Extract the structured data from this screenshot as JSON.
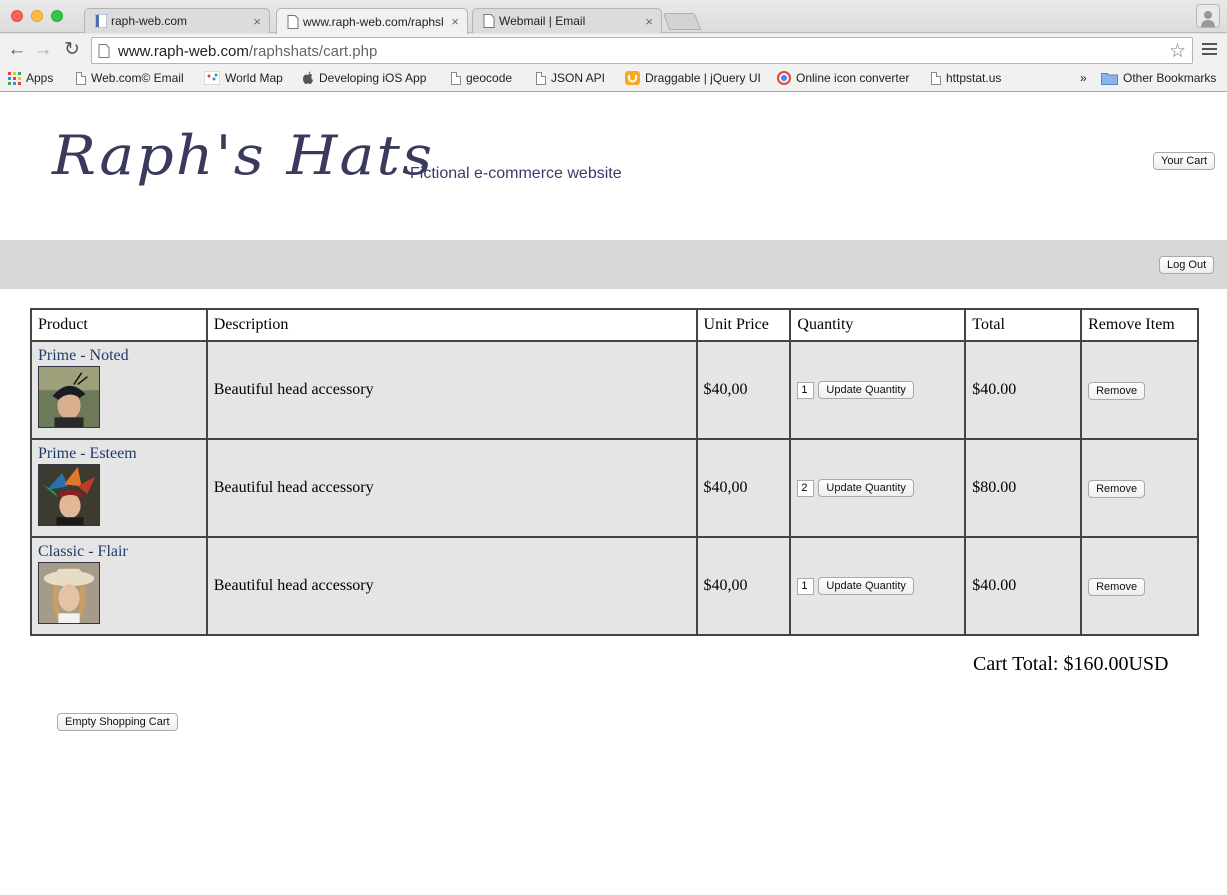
{
  "browser": {
    "tabs": [
      {
        "label": "raph-web.com",
        "active": false
      },
      {
        "label": "www.raph-web.com/raphsl",
        "active": true
      },
      {
        "label": "Webmail | Email",
        "active": false
      }
    ],
    "close_glyph": "×",
    "url_host": "www.raph-web.com",
    "url_path": "/raphshats/cart.php",
    "bookmarks": [
      {
        "label": "Apps",
        "icon": "apps-grid-icon"
      },
      {
        "label": "Web.com© Email",
        "icon": "page-icon"
      },
      {
        "label": "World Map",
        "icon": "map-icon"
      },
      {
        "label": "Developing iOS App",
        "icon": "apple-icon"
      },
      {
        "label": "geocode",
        "icon": "page-icon"
      },
      {
        "label": "JSON API",
        "icon": "page-icon"
      },
      {
        "label": "Draggable | jQuery UI",
        "icon": "jquery-icon"
      },
      {
        "label": "Online icon converter",
        "icon": "converter-icon"
      },
      {
        "label": "httpstat.us",
        "icon": "page-icon"
      }
    ],
    "overflow_label": "»",
    "other_bookmarks": "Other Bookmarks"
  },
  "site": {
    "logo": "Raph's Hats",
    "tagline": "Fictional e-commerce website",
    "cart_button": "Your Cart",
    "logout_button": "Log Out"
  },
  "cart": {
    "headers": [
      "Product",
      "Description",
      "Unit Price",
      "Quantity",
      "Total",
      "Remove Item"
    ],
    "items": [
      {
        "name": "Prime - Noted",
        "description": "Beautiful head accessory",
        "unit_price": "$40,00",
        "quantity": "1",
        "total": "$40.00"
      },
      {
        "name": "Prime - Esteem",
        "description": "Beautiful head accessory",
        "unit_price": "$40,00",
        "quantity": "2",
        "total": "$80.00"
      },
      {
        "name": "Classic - Flair",
        "description": "Beautiful head accessory",
        "unit_price": "$40,00",
        "quantity": "1",
        "total": "$40.00"
      }
    ],
    "update_label": "Update Quantity",
    "remove_label": "Remove",
    "cart_total": "Cart Total: $160.00USD",
    "empty_button": "Empty Shopping Cart"
  },
  "colors": {
    "link": "#1f3a6a",
    "logo": "#3a3a5c",
    "row_bg": "#e5e5e5",
    "bar_bg": "#d8d8d8"
  }
}
